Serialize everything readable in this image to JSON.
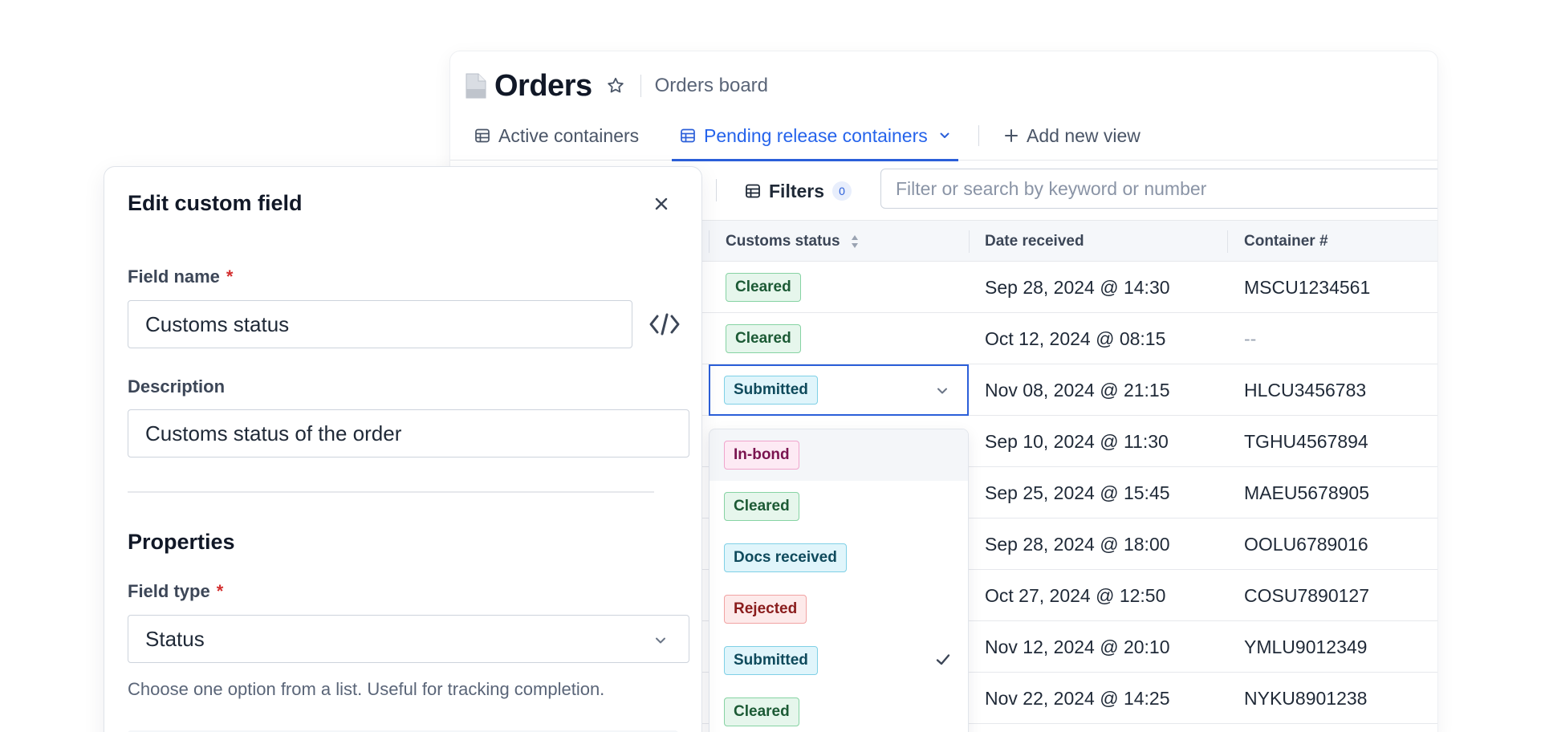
{
  "orders": {
    "title": "Orders",
    "breadcrumb": "Orders board",
    "tabs": [
      {
        "label": "Active containers",
        "icon": "table-icon",
        "active": false
      },
      {
        "label": "Pending release containers",
        "icon": "table-icon",
        "active": true
      },
      {
        "label": "Add new view",
        "icon": "plus-icon",
        "active": false
      }
    ],
    "filters": {
      "label": "Filters",
      "count": "0"
    },
    "search": {
      "placeholder": "Filter or search by keyword or number",
      "value": ""
    },
    "columns": [
      "Customs status",
      "Date received",
      "Container #"
    ],
    "rows": [
      {
        "status": "Cleared",
        "date": "Sep 28, 2024 @ 14:30",
        "container": "MSCU1234561"
      },
      {
        "status": "Cleared",
        "date": "Oct 12, 2024 @ 08:15",
        "container": "--"
      },
      {
        "status": "Submitted",
        "date": "Nov 08, 2024 @ 21:15",
        "container": "HLCU3456783"
      },
      {
        "status": "",
        "date": "Sep 10, 2024 @ 11:30",
        "container": "TGHU4567894"
      },
      {
        "status": "",
        "date": "Sep 25, 2024 @ 15:45",
        "container": "MAEU5678905"
      },
      {
        "status": "",
        "date": "Sep 28, 2024 @ 18:00",
        "container": "OOLU6789016"
      },
      {
        "status": "",
        "date": "Oct 27, 2024 @ 12:50",
        "container": "COSU7890127"
      },
      {
        "status": "",
        "date": "Nov 12, 2024 @ 20:10",
        "container": "YMLU9012349"
      },
      {
        "status": "",
        "date": "Nov 22, 2024 @ 14:25",
        "container": "NYKU8901238"
      }
    ],
    "status_options": [
      {
        "label": "In-bond",
        "kind": "inbond",
        "selected": false
      },
      {
        "label": "Cleared",
        "kind": "cleared",
        "selected": false
      },
      {
        "label": "Docs received",
        "kind": "docs",
        "selected": false
      },
      {
        "label": "Rejected",
        "kind": "rejected",
        "selected": false
      },
      {
        "label": "Submitted",
        "kind": "submitted",
        "selected": true
      },
      {
        "label": "Cleared",
        "kind": "cleared",
        "selected": false
      }
    ]
  },
  "panel": {
    "title": "Edit custom field",
    "field_name_label": "Field name",
    "field_name_value": "Customs status",
    "required_mark": "*",
    "description_label": "Description",
    "description_value": "Customs status of the order",
    "properties_title": "Properties",
    "field_type_label": "Field type",
    "field_type_value": "Status",
    "helper_text": "Choose one option from a list. Useful for tracking completion."
  },
  "colors": {
    "accent": "#2b5fd9",
    "required": "#d32f2f",
    "cleared_bg": "#e6f6ec",
    "submitted_bg": "#e0f5fb",
    "rejected_bg": "#fdeaea",
    "inbond_bg": "#fdeaf4"
  }
}
